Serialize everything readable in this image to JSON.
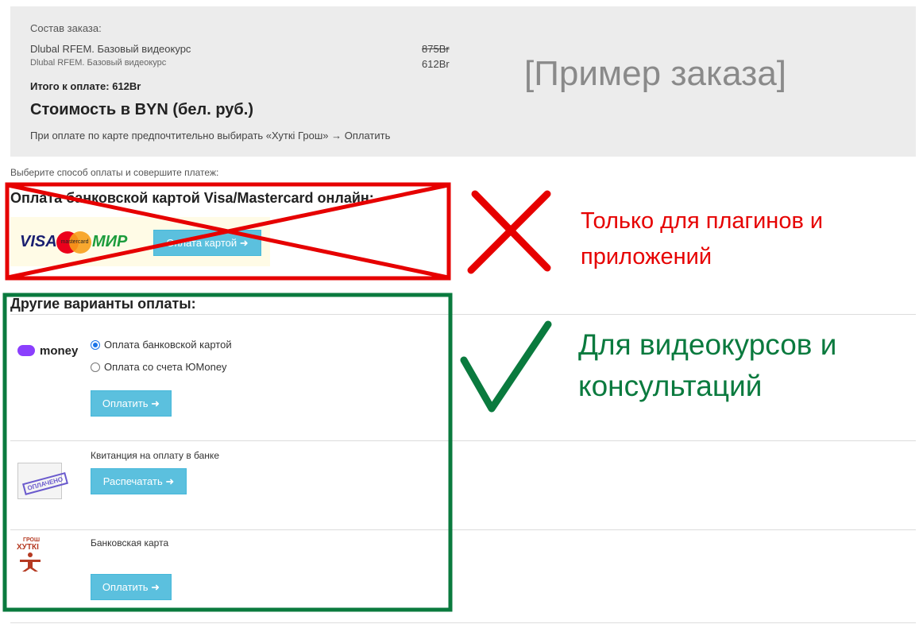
{
  "order": {
    "heading": "Состав заказа:",
    "item_name": "Dlubal RFEM. Базовый видеокурс",
    "item_price_old": "875Br",
    "item_name_small": "Dlubal RFEM. Базовый видеокурс",
    "item_price_new": "612Br",
    "total": "Итого к оплате: 612Br",
    "currency_note": "Стоимость в BYN (бел. руб.)",
    "card_tip": "При оплате по карте предпочтительно выбирать «Хуткі Грош» → Оплатить",
    "sample_label": "[Пример заказа]"
  },
  "instruction": "Выберите способ оплаты и совершите платеж:",
  "card_online": {
    "title": "Оплата банковской картой Visa/Mastercard онлайн:",
    "logos": [
      "VISA",
      "mastercard",
      "МИР"
    ],
    "button_label": "Оплата картой"
  },
  "other": {
    "title": "Другие варианты оплаты:",
    "yoomoney": {
      "logo_text": "money",
      "options": [
        "Оплата банковской картой",
        "Оплата со счета ЮMoney"
      ],
      "selected": 0,
      "button_label": "Оплатить"
    },
    "receipt": {
      "label": "Квитанция на оплату в банке",
      "stamp": "ОПЛАЧЕНО",
      "button_label": "Распечатать"
    },
    "bank_card": {
      "logo_top": "ГРОШ",
      "logo_main": "ХУТКІ",
      "label": "Банковская карта",
      "button_label": "Оплатить"
    }
  },
  "annotations": {
    "not_allowed": "Только для плагинов и приложений",
    "allowed": "Для видеокурсов и консультаций"
  },
  "colors": {
    "button": "#5bc0de",
    "red_mark": "#e60000",
    "green_mark": "#0a7a3e",
    "summary_bg": "#ececec"
  }
}
